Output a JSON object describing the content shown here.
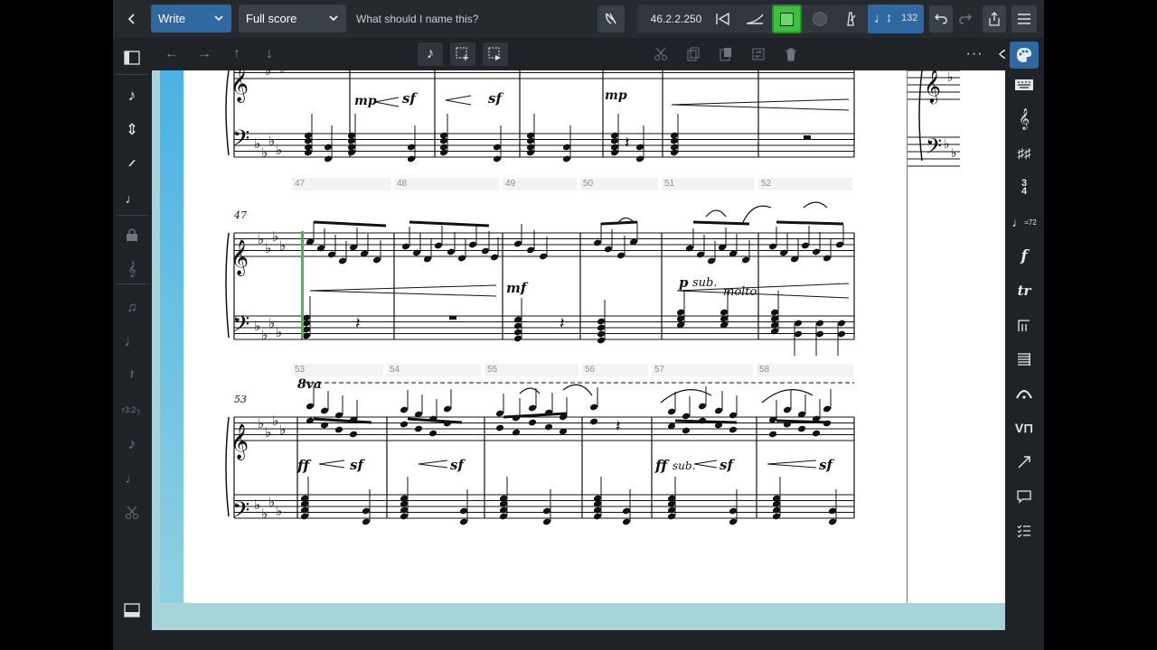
{
  "toolbar": {
    "mode_label": "Write",
    "layout_label": "Full score",
    "title_placeholder": "What should I name this?",
    "version": "46.2.2.250",
    "tempo": "132"
  },
  "measures": {
    "system2": [
      "47",
      "48",
      "49",
      "50",
      "51",
      "52"
    ],
    "system3": [
      "53",
      "54",
      "55",
      "56",
      "57",
      "58"
    ]
  },
  "score_text": {
    "sys2_start": "47",
    "sys3_start": "53",
    "triplet": "3",
    "mp": "mp",
    "sf": "sf",
    "mf": "mf",
    "p": "p",
    "sub": "sub.",
    "molto": "molto",
    "ff": "ff",
    "ottava": "8va"
  },
  "colors": {
    "accent_blue": "#2e6aa1",
    "selected_green": "#3fbf3f",
    "canvas_bg": "#a6d4d8",
    "strip": "#4ab2e3"
  }
}
